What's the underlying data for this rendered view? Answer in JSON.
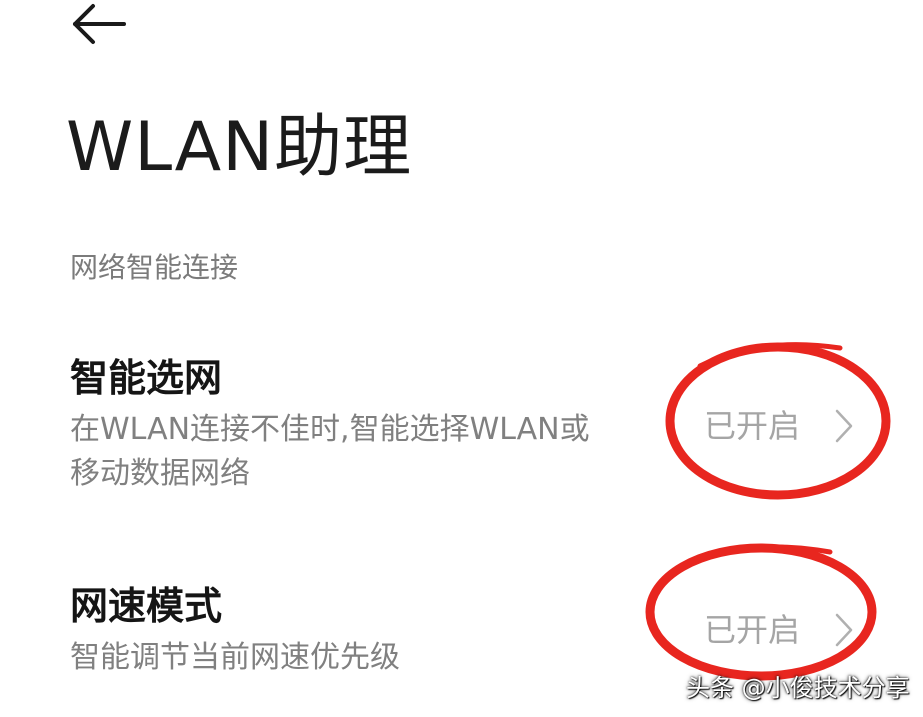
{
  "header": {
    "back_icon": "arrow-left-icon",
    "title": "WLAN助理"
  },
  "section": {
    "label": "网络智能连接"
  },
  "settings": [
    {
      "title": "智能选网",
      "description_line1": "在WLAN连接不佳时,智能选择WLAN或",
      "description_line2": "移动数据网络",
      "value": "已开启",
      "icon": "chevron-right-icon"
    },
    {
      "title": "网速模式",
      "description_line1": "智能调节当前网速优先级",
      "value": "已开启",
      "icon": "chevron-right-icon"
    }
  ],
  "annotations": {
    "highlight_color": "#e8261f"
  },
  "watermark": {
    "text": "头条 @小俊技术分享"
  },
  "colors": {
    "background": "#ffffff",
    "title_text": "#151515",
    "secondary_text": "#808080",
    "value_text": "#a5a5a5"
  }
}
